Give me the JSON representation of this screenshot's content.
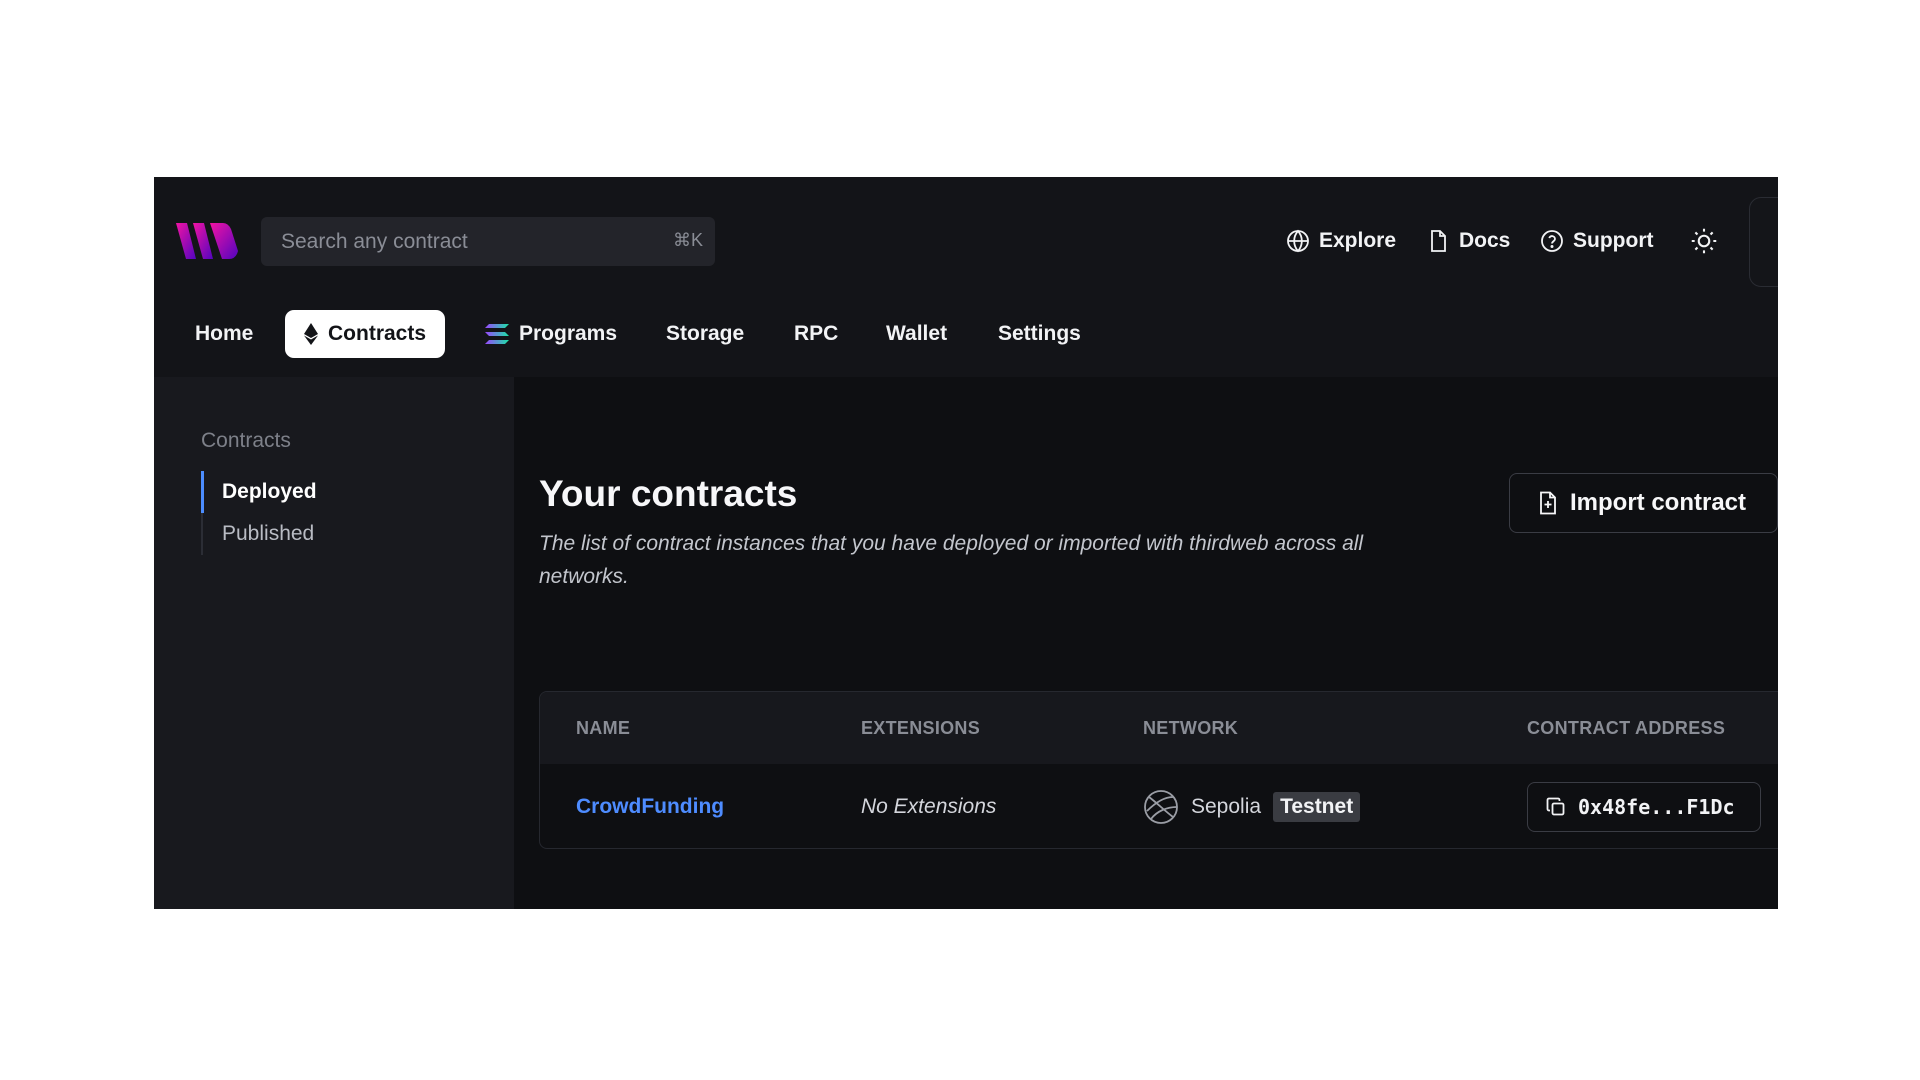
{
  "header": {
    "search": {
      "placeholder": "Search any contract",
      "shortcut": "⌘K"
    },
    "links": {
      "explore": "Explore",
      "docs": "Docs",
      "support": "Support"
    }
  },
  "nav": {
    "tabs": [
      {
        "label": "Home"
      },
      {
        "label": "Contracts",
        "icon": "ethereum-icon",
        "active": true
      },
      {
        "label": "Programs",
        "icon": "solana-icon"
      },
      {
        "label": "Storage"
      },
      {
        "label": "RPC"
      },
      {
        "label": "Wallet"
      },
      {
        "label": "Settings"
      }
    ]
  },
  "sidebar": {
    "heading": "Contracts",
    "items": [
      {
        "label": "Deployed",
        "active": true
      },
      {
        "label": "Published"
      }
    ]
  },
  "main": {
    "title": "Your contracts",
    "description": "The list of contract instances that you have deployed or imported with thirdweb across all networks.",
    "import_button": "Import contract",
    "table": {
      "columns": [
        "NAME",
        "EXTENSIONS",
        "NETWORK",
        "CONTRACT ADDRESS"
      ],
      "rows": [
        {
          "name": "CrowdFunding",
          "extensions": "No Extensions",
          "network": "Sepolia",
          "network_badge": "Testnet",
          "address": "0x48fe...F1Dc"
        }
      ]
    }
  },
  "colors": {
    "background": "#131418",
    "main_background": "#0e0f12",
    "link": "#4e8cff",
    "sidebar_active_indicator": "#4c8dff",
    "logo_gradient": [
      "#f213a4",
      "#5204bf"
    ]
  }
}
